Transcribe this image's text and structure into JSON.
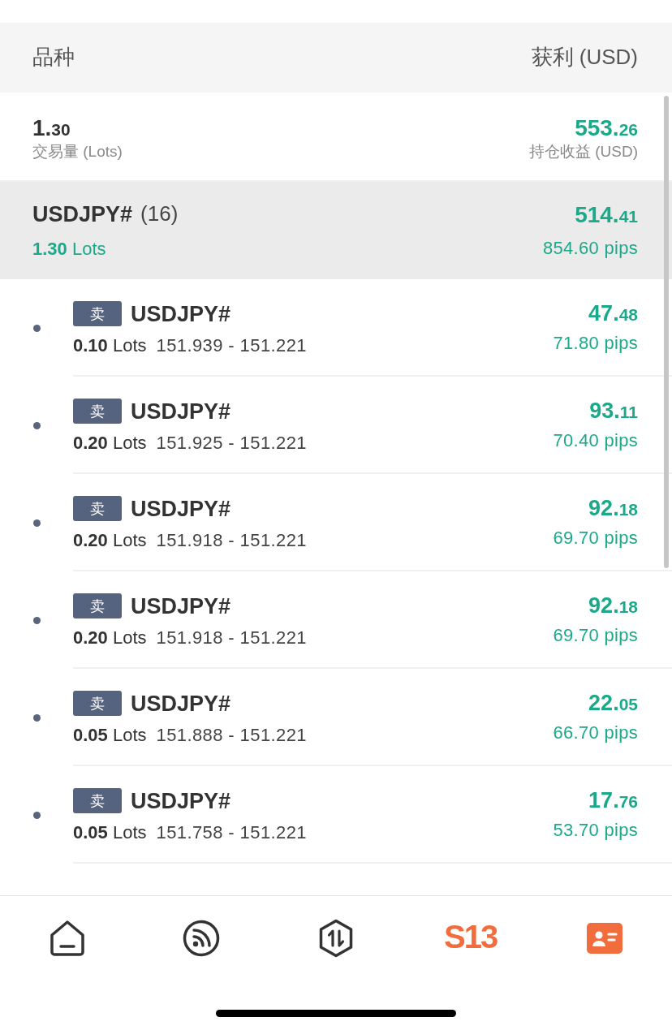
{
  "header": {
    "symbol_heading": "品种",
    "profit_heading": "获利 (USD)"
  },
  "summary": {
    "volume": "1.30",
    "volume_label": "交易量 (Lots)",
    "profit": "553.26",
    "profit_label": "持仓收益 (USD)"
  },
  "group": {
    "symbol": "USDJPY#",
    "count": "(16)",
    "lots": "**1.30** Lots",
    "profit": "514.41",
    "pips": "854.60 pips"
  },
  "positions": [
    {
      "side": "卖",
      "symbol": "USDJPY#",
      "lots": "**0.10** Lots",
      "prices": "151.939 - 151.221",
      "profit": "47.48",
      "pips": "71.80 pips"
    },
    {
      "side": "卖",
      "symbol": "USDJPY#",
      "lots": "**0.20** Lots",
      "prices": "151.925 - 151.221",
      "profit": "93.11",
      "pips": "70.40 pips"
    },
    {
      "side": "卖",
      "symbol": "USDJPY#",
      "lots": "**0.20** Lots",
      "prices": "151.918 - 151.221",
      "profit": "92.18",
      "pips": "69.70 pips"
    },
    {
      "side": "卖",
      "symbol": "USDJPY#",
      "lots": "**0.20** Lots",
      "prices": "151.918 - 151.221",
      "profit": "92.18",
      "pips": "69.70 pips"
    },
    {
      "side": "卖",
      "symbol": "USDJPY#",
      "lots": "**0.05** Lots",
      "prices": "151.888 - 151.221",
      "profit": "22.05",
      "pips": "66.70 pips"
    },
    {
      "side": "卖",
      "symbol": "USDJPY#",
      "lots": "**0.05** Lots",
      "prices": "151.758 - 151.221",
      "profit": "17.76",
      "pips": "53.70 pips"
    }
  ],
  "nav": [
    {
      "kind": "icon",
      "selected": false
    },
    {
      "kind": "icon",
      "selected": false
    },
    {
      "kind": "icon",
      "selected": false
    },
    {
      "kind": "logo",
      "label": "S13",
      "selected": false
    },
    {
      "kind": "icon",
      "selected": true
    }
  ]
}
